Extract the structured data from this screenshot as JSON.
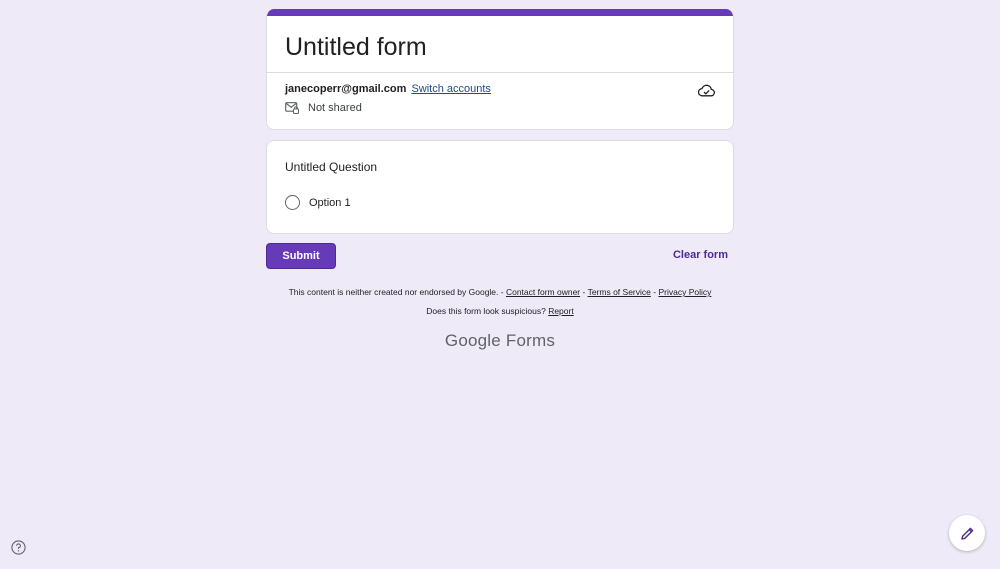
{
  "form": {
    "title": "Untitled form",
    "account_email": "janecoperr@gmail.com",
    "switch_accounts": "Switch accounts",
    "shared_status": "Not shared"
  },
  "question": {
    "title": "Untitled Question",
    "options": [
      "Option 1"
    ]
  },
  "actions": {
    "submit_label": "Submit",
    "clear_label": "Clear form"
  },
  "footer": {
    "disclaimer": "This content is neither created nor endorsed by Google. -",
    "contact_owner": "Contact form owner",
    "sep1": "-",
    "terms": "Terms of Service",
    "sep2": "-",
    "privacy": "Privacy Policy",
    "suspicious": "Does this form look suspicious?",
    "report": "Report",
    "brand_google": "Google",
    "brand_forms": "Forms"
  },
  "icons": {
    "shared": "mail-lock-icon",
    "cloud": "cloud-check-icon",
    "help": "help-circle-icon",
    "edit": "pencil-icon"
  },
  "colors": {
    "accent": "#673ab7",
    "background": "#efeaf8"
  }
}
